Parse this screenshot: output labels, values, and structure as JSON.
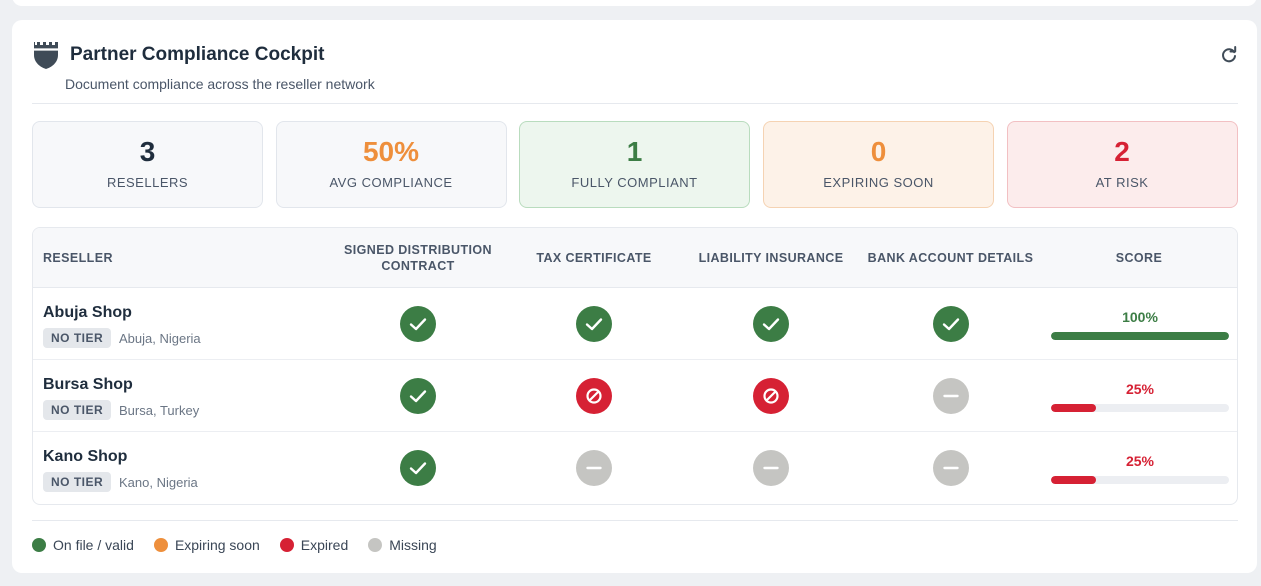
{
  "header": {
    "title": "Partner Compliance Cockpit",
    "subtitle": "Document compliance across the reseller network",
    "shield_icon": "shield-icon",
    "refresh_icon": "refresh-icon"
  },
  "stats": [
    {
      "value": "3",
      "label": "RESELLERS",
      "color": "#1f2d3d"
    },
    {
      "value": "50%",
      "label": "AVG COMPLIANCE",
      "color": "#ee8f3c"
    },
    {
      "value": "1",
      "label": "FULLY COMPLIANT",
      "color": "#3c7d45"
    },
    {
      "value": "0",
      "label": "EXPIRING SOON",
      "color": "#ee8f3c"
    },
    {
      "value": "2",
      "label": "AT RISK",
      "color": "#d62134"
    }
  ],
  "table": {
    "columns": [
      "RESELLER",
      "SIGNED DISTRIBUTION CONTRACT",
      "TAX CERTIFICATE",
      "LIABILITY INSURANCE",
      "BANK ACCOUNT DETAILS",
      "SCORE"
    ],
    "rows": [
      {
        "name": "Abuja Shop",
        "tier": "NO TIER",
        "location": "Abuja, Nigeria",
        "statuses": [
          "valid",
          "valid",
          "valid",
          "valid"
        ],
        "score": "100%",
        "score_value": 1.0,
        "score_color": "#3c7d45"
      },
      {
        "name": "Bursa Shop",
        "tier": "NO TIER",
        "location": "Bursa, Turkey",
        "statuses": [
          "valid",
          "expired",
          "expired",
          "missing"
        ],
        "score": "25%",
        "score_value": 0.25,
        "score_color": "#d62134"
      },
      {
        "name": "Kano Shop",
        "tier": "NO TIER",
        "location": "Kano, Nigeria",
        "statuses": [
          "valid",
          "missing",
          "missing",
          "missing"
        ],
        "score": "25%",
        "score_value": 0.25,
        "score_color": "#d62134"
      }
    ]
  },
  "legend": [
    {
      "label": "On file / valid",
      "color": "#3c7d45"
    },
    {
      "label": "Expiring soon",
      "color": "#ee8f3c"
    },
    {
      "label": "Expired",
      "color": "#d62134"
    },
    {
      "label": "Missing",
      "color": "#c5c5c2"
    }
  ]
}
